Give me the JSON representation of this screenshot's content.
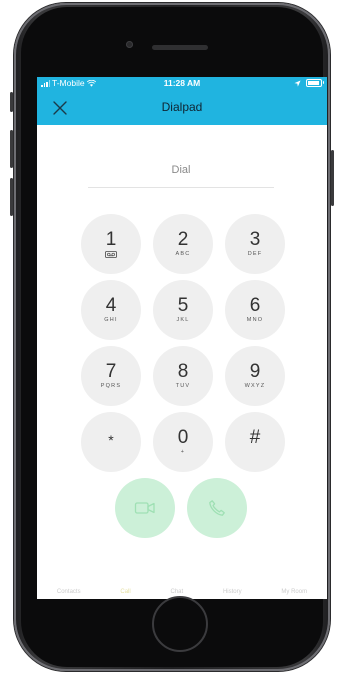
{
  "status_bar": {
    "carrier": "T-Mobile",
    "time": "11:28 AM",
    "battery_level": 0.9
  },
  "nav": {
    "title": "Dialpad",
    "close_icon": "close-icon"
  },
  "dial_input": {
    "placeholder": "Dial"
  },
  "keypad": [
    {
      "digit": "1",
      "letters": "",
      "icon": "voicemail-icon"
    },
    {
      "digit": "2",
      "letters": "ABC"
    },
    {
      "digit": "3",
      "letters": "DEF"
    },
    {
      "digit": "4",
      "letters": "GHI"
    },
    {
      "digit": "5",
      "letters": "JKL"
    },
    {
      "digit": "6",
      "letters": "MNO"
    },
    {
      "digit": "7",
      "letters": "PQRS"
    },
    {
      "digit": "8",
      "letters": "TUV"
    },
    {
      "digit": "9",
      "letters": "WXYZ"
    },
    {
      "digit": "*",
      "letters": ""
    },
    {
      "digit": "0",
      "letters": "+"
    },
    {
      "digit": "#",
      "letters": ""
    }
  ],
  "actions": {
    "video_call_icon": "video-camera-icon",
    "voice_call_icon": "phone-icon",
    "call_button_color": "#ccf0d8"
  },
  "tabs": [
    {
      "label": "Contacts"
    },
    {
      "label": "Call"
    },
    {
      "label": "Chat"
    },
    {
      "label": "History"
    },
    {
      "label": "My Room"
    }
  ],
  "colors": {
    "accent": "#20b4e0",
    "key_background": "#efefef"
  }
}
